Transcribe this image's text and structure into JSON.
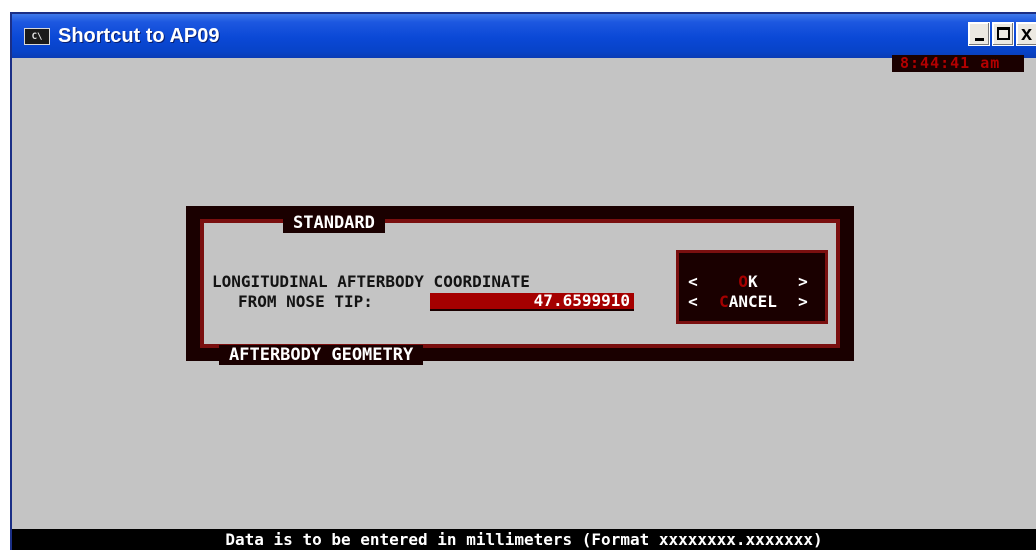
{
  "window": {
    "title": "Shortcut to AP09",
    "icon": "console-icon",
    "icon_text": "C\\",
    "controls": {
      "minimize_icon": "minimize-icon",
      "maximize_icon": "maximize-icon",
      "close_icon": "close-icon",
      "close_glyph": "x"
    }
  },
  "clock": {
    "text": "8:44:41 am"
  },
  "dialog": {
    "title": "STANDARD",
    "footer": "AFTERBODY GEOMETRY",
    "label_line1": "LONGITUDINAL AFTERBODY COORDINATE",
    "label_line2": "FROM NOSE TIP:",
    "value": "47.6599910",
    "buttons": {
      "ok": {
        "left": "<",
        "hotkey": "O",
        "rest": "K",
        "right": ">"
      },
      "cancel": {
        "left": "<",
        "hotkey": "C",
        "rest": "ANCEL",
        "right": ">"
      }
    }
  },
  "status_bar": {
    "text": "Data is to be entered in millimeters (Format xxxxxxxx.xxxxxxx)"
  },
  "colors": {
    "title_bar": "#0a48d6",
    "background": "#c4c4c4",
    "dialog_border": "#7a0f0f",
    "input_fill": "#a50000",
    "hotkey": "#a50000"
  }
}
